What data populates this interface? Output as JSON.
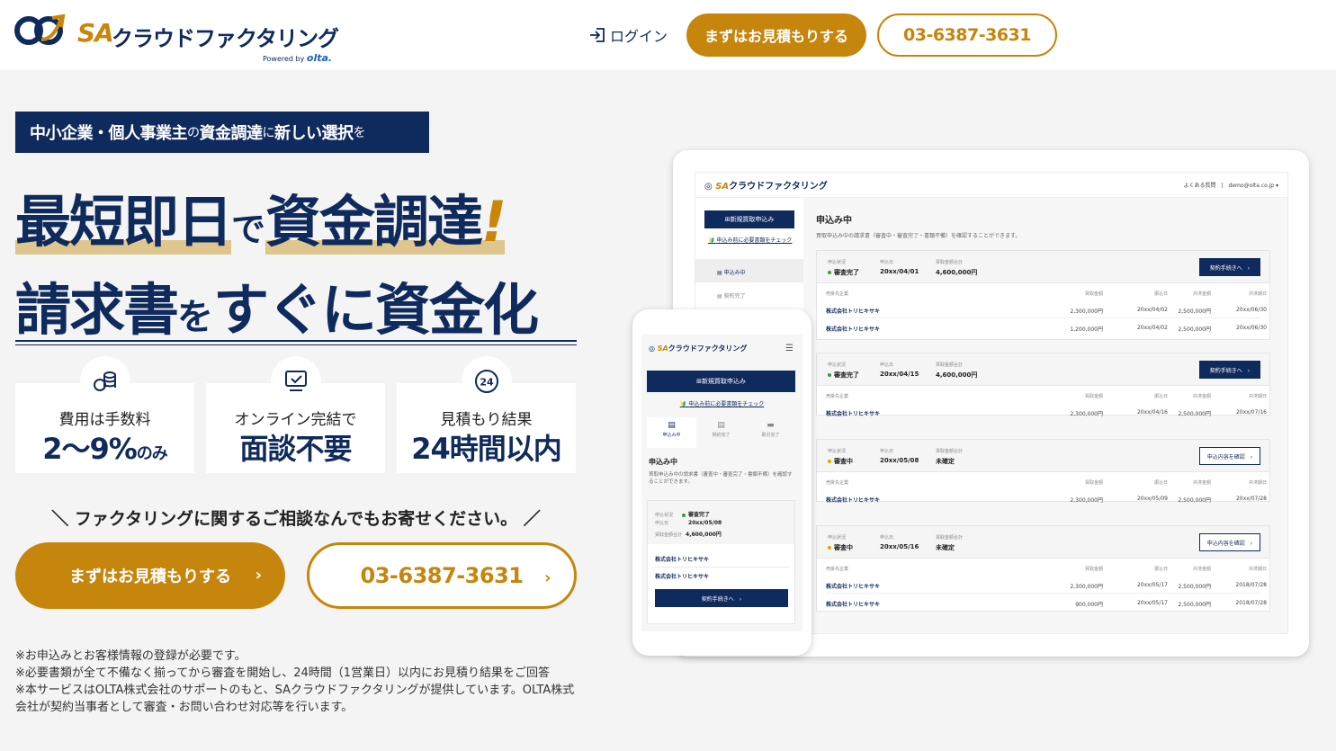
{
  "header": {
    "logo": {
      "sa": "SA",
      "name": "クラウドファクタリング",
      "powered": "Powered by",
      "olta": "olta."
    },
    "login_label": "ログイン",
    "estimate_label": "まずはお見積もりする",
    "tel_label": "03-6387-3631"
  },
  "hero": {
    "tagline_a": "中小企業・個人事業主",
    "tagline_b": "の",
    "tagline_c": "資金調達",
    "tagline_d": "に",
    "tagline_e": "新しい選択",
    "tagline_f": "を",
    "h1_a": "最短即日",
    "h1_b": "で",
    "h1_c": "資金調達",
    "h1_d": "!",
    "h2_a": "請求書",
    "h2_b": "を",
    "h2_c": "すぐに",
    "h2_d": "資金化"
  },
  "features": [
    {
      "icon": "coins-icon",
      "line1": "費用は手数料",
      "line2": "2〜9%",
      "line2_suffix": "のみ"
    },
    {
      "icon": "laptop-check-icon",
      "line1": "オンライン完結で",
      "line2": "面談不要",
      "line2_suffix": ""
    },
    {
      "icon": "24h-icon",
      "line1": "見積もり結果",
      "line2": "24時間以内",
      "line2_suffix": ""
    }
  ],
  "consult": "＼ ファクタリングに関するご相談なんでもお寄せください。 ／",
  "cta": {
    "estimate_label": "まずはお見積もりする",
    "tel_label": "03-6387-3631",
    "chevron": "›"
  },
  "notes": [
    "※お申込みとお客様情報の登録が必要です。",
    "※必要書類が全て不備なく揃ってから審査を開始し、24時間（1営業日）以内にお見積り結果をご回答",
    "※本サービスはOLTA株式会社のサポートのもと、SAクラウドファクタリングが提供しています。OLTA株式会社が契約当事者として審査・お問い合わせ対応等を行います。"
  ],
  "tablet": {
    "logo_sa": "SA",
    "logo_name": "クラウドファクタリング",
    "top_right": "よくある質問　|　demo@olta.co.jp ▾",
    "new_button": "新規買取申込み",
    "check_link": "申込み前に必要書類をチェック",
    "nav": [
      "申込み中",
      "契約完了"
    ],
    "title": "申込み中",
    "subtitle": "買取申込み中の請求書（審査中・審査完了・書類不備）を確認することができます。",
    "labels": {
      "status": "申込状況",
      "date": "申込日",
      "total": "買取金額合計",
      "seller": "売掛先企業",
      "amount": "買取金額",
      "transfer": "振込日",
      "settle": "弁済金額",
      "due": "弁済期日"
    },
    "cards": [
      {
        "status": "審査完了",
        "status_color": "#2e9e3e",
        "date": "20xx/04/01",
        "total": "4,600,000円",
        "button": "契約手続きへ　›",
        "button_style": "solid",
        "rows": [
          {
            "name": "株式会社トリヒキサキ",
            "amount": "2,300,000円",
            "transfer": "20xx/04/02",
            "settle": "2,500,000円",
            "due": "20xx/06/30"
          },
          {
            "name": "株式会社トリヒキサキ",
            "amount": "1,200,000円",
            "transfer": "20xx/04/02",
            "settle": "2,500,000円",
            "due": "20xx/06/30"
          }
        ]
      },
      {
        "status": "審査完了",
        "status_color": "#2e9e3e",
        "date": "20xx/04/15",
        "total": "4,600,000円",
        "button": "契約手続きへ　›",
        "button_style": "solid",
        "rows": [
          {
            "name": "株式会社トリヒキサキ",
            "amount": "2,300,000円",
            "transfer": "20xx/04/16",
            "settle": "2,500,000円",
            "due": "20xx/07/16"
          }
        ]
      },
      {
        "status": "審査中",
        "status_color": "#e0a800",
        "date": "20xx/05/08",
        "total": "未確定",
        "button": "申込内容を確認　›",
        "button_style": "outline",
        "rows": [
          {
            "name": "株式会社トリヒキサキ",
            "amount": "2,300,000円",
            "transfer": "20xx/05/09",
            "settle": "2,500,000円",
            "due": "20xx/07/28"
          }
        ]
      },
      {
        "status": "審査中",
        "status_color": "#e0a800",
        "date": "20xx/05/16",
        "total": "未確定",
        "button": "申込内容を確認　›",
        "button_style": "outline",
        "rows": [
          {
            "name": "株式会社トリヒキサキ",
            "amount": "2,300,000円",
            "transfer": "20xx/05/17",
            "settle": "2,500,000円",
            "due": "2018/07/28"
          },
          {
            "name": "株式会社トリヒキサキ",
            "amount": "900,000円",
            "transfer": "20xx/05/17",
            "settle": "2,500,000円",
            "due": "2018/07/28"
          }
        ]
      }
    ]
  },
  "phone": {
    "logo_sa": "SA",
    "logo_name": "クラウドファクタリング",
    "new_button": "新規買取申込み",
    "check_link": "申込み前に必要書類をチェック",
    "tabs": [
      "申込み中",
      "契約完了",
      "取引完了"
    ],
    "title": "申込み中",
    "subtitle": "買取申込み中の請求書（審査中・審査完了・書類不備）を確認することができます。",
    "status_label": "申込状況",
    "status": "審査完了",
    "date_label": "申込日",
    "date": "20xx/05/08",
    "total_label": "買取金額合計",
    "total": "4,600,000円",
    "companies": [
      "株式会社トリヒキサキ",
      "株式会社トリヒキサキ"
    ],
    "button": "契約手続きへ　›"
  },
  "colors": {
    "navy": "#0f2a5c",
    "gold": "#c6860d",
    "bg": "#f4f4f4"
  }
}
